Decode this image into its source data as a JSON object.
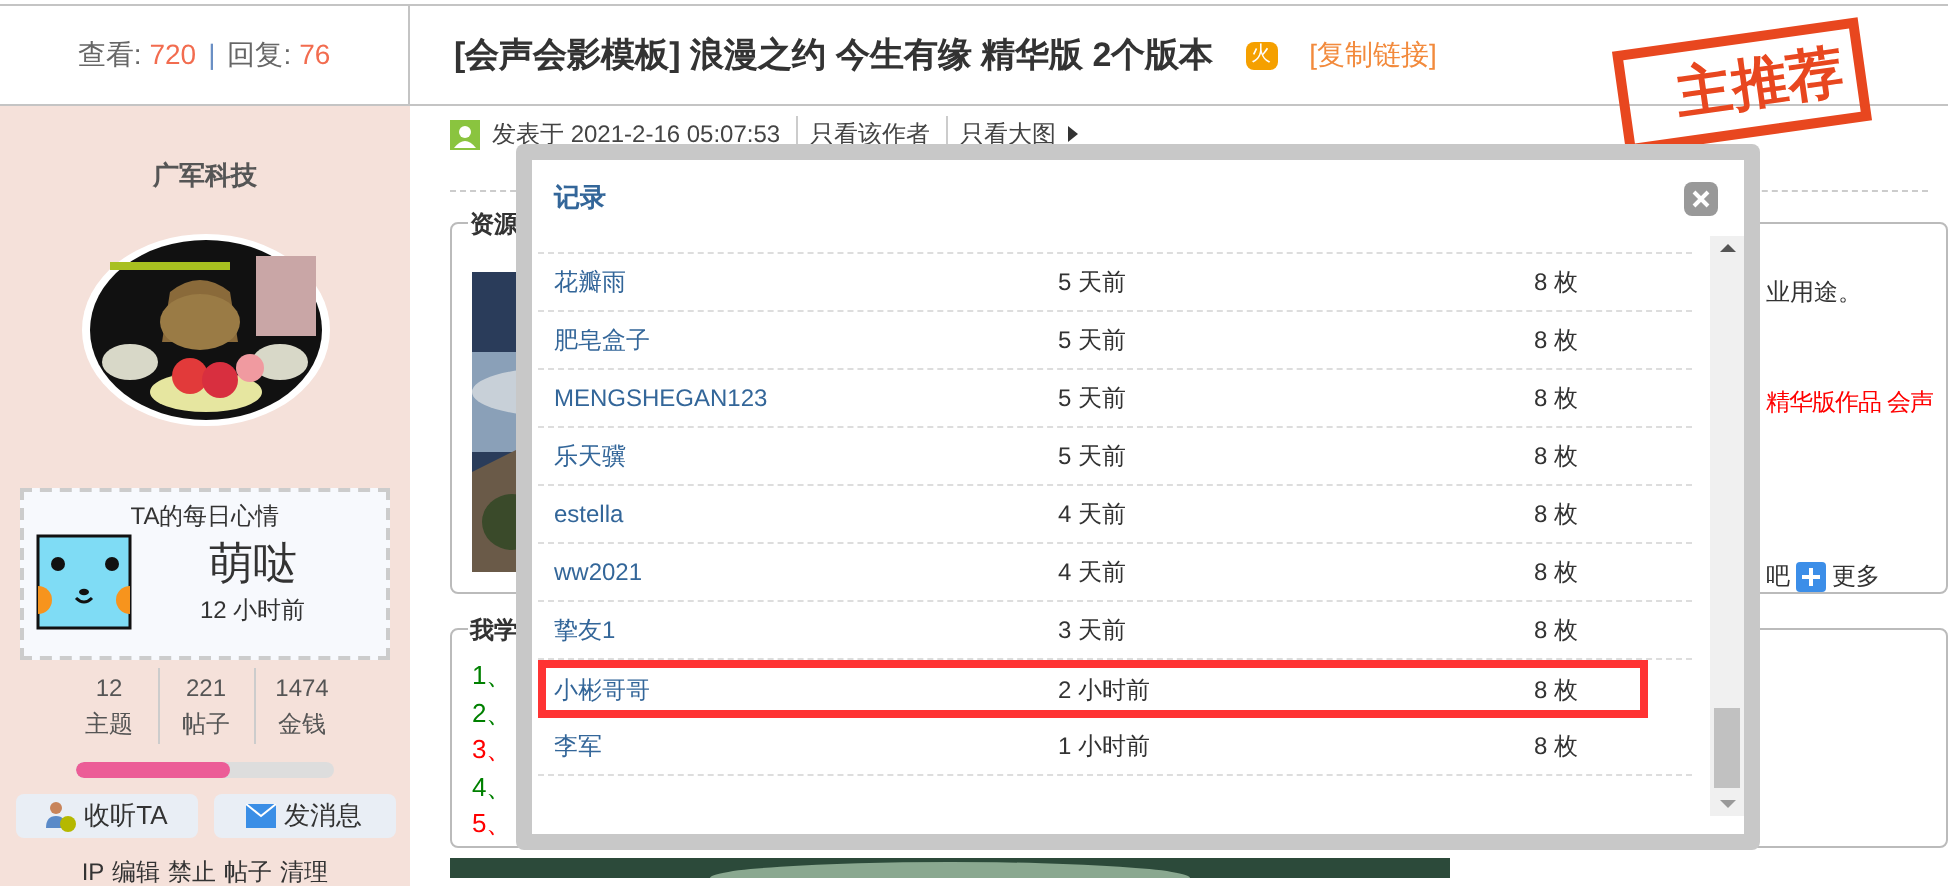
{
  "header": {
    "views_label": "查看:",
    "views": "720",
    "separator": "|",
    "replies_label": "回复:",
    "replies": "76"
  },
  "thread": {
    "title": "[会声会影模板] 浪漫之约 今生有缘 精华版 2个版本",
    "hot_badge": "火",
    "copy_link": "[复制链接]"
  },
  "author": {
    "name": "广军科技",
    "mood_title": "TA的每日心情",
    "mood": "萌哒",
    "mood_time": "12 小时前",
    "stats": [
      {
        "value": "12",
        "label": "主题"
      },
      {
        "value": "221",
        "label": "帖子"
      },
      {
        "value": "1474",
        "label": "金钱"
      }
    ],
    "level": 0.6,
    "buttons": [
      {
        "kind": "follow",
        "label": "收听TA"
      },
      {
        "kind": "message",
        "label": "发消息"
      }
    ],
    "admin_links": [
      "IP",
      "编辑",
      "禁止",
      "帖子",
      "清理"
    ]
  },
  "post": {
    "meta": "发表于 2021-2-16 05:07:53",
    "links": [
      "只看该作者",
      "只看大图"
    ],
    "stamp": "主推荐",
    "resource_box": {
      "legend": "资源",
      "lines": [
        {
          "text": "业用途。",
          "color": "#333333"
        },
        {
          "text": "精华版作品 会声",
          "color": "#ff0000"
        }
      ],
      "share_label": "吧",
      "more": "更多"
    },
    "notes_box": {
      "legend": "我学",
      "lines": [
        {
          "text": "1、",
          "color": "#008000"
        },
        {
          "text": "2、",
          "color": "#008000"
        },
        {
          "text": "3、",
          "color": "#ff0000"
        },
        {
          "text": "4、",
          "color": "#008000"
        },
        {
          "text": "5、",
          "color": "#ff0000"
        }
      ]
    }
  },
  "modal": {
    "title": "记录",
    "rows": [
      {
        "name": "花瓣雨",
        "time": "5 天前",
        "count": "8 枚",
        "highlighted": false
      },
      {
        "name": "肥皂盒子",
        "time": "5 天前",
        "count": "8 枚",
        "highlighted": false
      },
      {
        "name": "MENGSHEGAN123",
        "time": "5 天前",
        "count": "8 枚",
        "highlighted": false
      },
      {
        "name": "乐天骥",
        "time": "5 天前",
        "count": "8 枚",
        "highlighted": false
      },
      {
        "name": "estella",
        "time": "4 天前",
        "count": "8 枚",
        "highlighted": false
      },
      {
        "name": "ww2021",
        "time": "4 天前",
        "count": "8 枚",
        "highlighted": false
      },
      {
        "name": "挚友1",
        "time": "3 天前",
        "count": "8 枚",
        "highlighted": false
      },
      {
        "name": "小彬哥哥",
        "time": "2 小时前",
        "count": "8 枚",
        "highlighted": true
      },
      {
        "name": "李军",
        "time": "1 小时前",
        "count": "8 枚",
        "highlighted": false
      }
    ]
  }
}
